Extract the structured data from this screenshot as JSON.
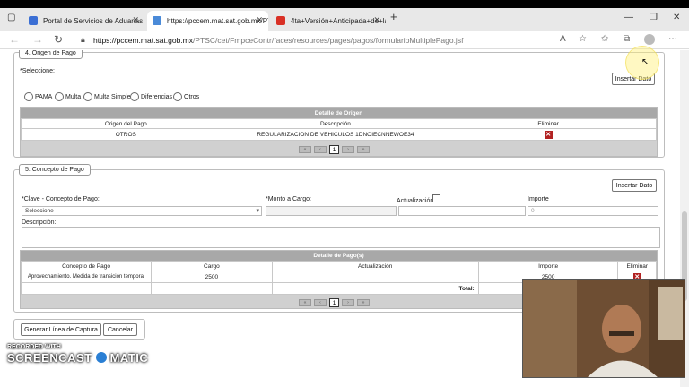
{
  "browser": {
    "tabs": [
      {
        "title": "Portal de Servicios de Aduanas",
        "favicon_color": "#3b6fd4"
      },
      {
        "title": "https://pccem.mat.sat.gob.mx/PT",
        "favicon_color": "#4a8ad8"
      },
      {
        "title": "4ta+Versión+Anticipada+de+la",
        "favicon_color": "#d93025"
      }
    ],
    "new_tab": "+",
    "url_host": "https://pccem.mat.sat.gob.mx",
    "url_path": "/PTSC/cet/FmpceContr/faces/resources/pages/pagos/formularioMultiplePago.jsf"
  },
  "origen": {
    "legend": "4. Origen de Pago",
    "seleccione_label": "*Seleccione:",
    "insert_button": "Insertar Dato",
    "radios": [
      "PAMA",
      "Multa",
      "Multa Simple",
      "Diferencias",
      "Otros"
    ],
    "grid": {
      "title": "Detalle de Origen",
      "columns": [
        "Origen del Pago",
        "Descripción",
        "Eliminar"
      ],
      "rows": [
        [
          "OTROS",
          "REGULARIZACION DE VEHICULOS 1DNOIECNNEWOE34"
        ]
      ]
    },
    "page": "1"
  },
  "concepto": {
    "legend": "5. Concepto de Pago",
    "insert_button": "Insertar Dato",
    "clave_label": "*Clave - Concepto de Pago:",
    "monto_label": "*Monto a Cargo:",
    "actualizacion_label": "Actualización",
    "importe_label": "Importe",
    "select_value": "Seleccione",
    "importe_value": "0",
    "descripcion_label": "Descripción:",
    "grid": {
      "title": "Detalle de Pago(s)",
      "columns": [
        "Concepto de Pago",
        "Cargo",
        "Actualización",
        "Importe",
        "Eliminar"
      ],
      "rows": [
        [
          "Aprovechamiento. Medida de transición temporal",
          "2500",
          "",
          "2500"
        ]
      ],
      "total_label": "Total:"
    },
    "page": "1"
  },
  "actions": {
    "generar": "Generar Línea de Captura",
    "cancelar": "Cancelar"
  },
  "watermark": {
    "recorded": "RECORDED WITH",
    "brand_left": "SCREENCAST",
    "brand_right": "MATIC"
  },
  "colors": {
    "grid_header": "#a8a8a8",
    "delete_icon": "#b22222",
    "brand_logo": "#2a7fd4"
  }
}
